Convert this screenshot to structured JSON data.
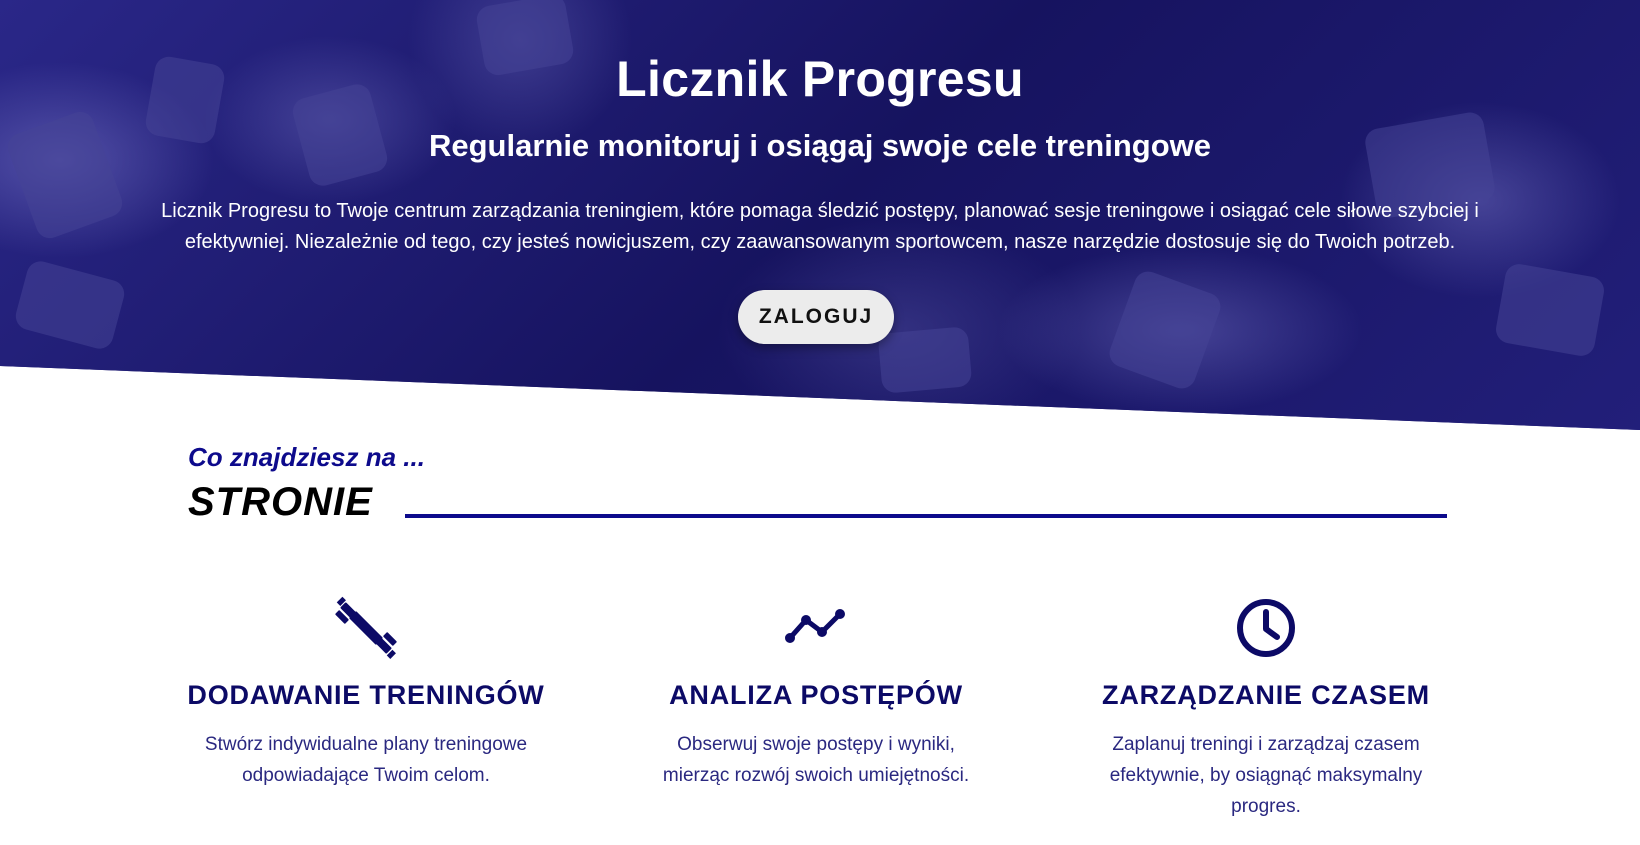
{
  "hero": {
    "title": "Licznik Progresu",
    "subtitle": "Regularnie monitoruj i osiągaj swoje cele treningowe",
    "description": "Licznik Progresu to Twoje centrum zarządzania treningiem, które pomaga śledzić postępy, planować sesje treningowe i osiągać cele siłowe szybciej i efektywniej. Niezależnie od tego, czy jesteś nowicjuszem, czy zaawansowanym sportowcem, nasze narzędzie dostosuje się do Twoich potrzeb.",
    "login_label": "ZALOGUJ"
  },
  "section": {
    "kicker": "Co znajdziesz na ...",
    "title": "STRONIE"
  },
  "features": [
    {
      "icon": "dumbbell-icon",
      "title": "DODAWANIE TRENINGÓW",
      "text": "Stwórz indywidualne plany treningowe odpowiadające Twoim celom."
    },
    {
      "icon": "chart-line-icon",
      "title": "ANALIZA POSTĘPÓW",
      "text": "Obserwuj swoje postępy i wyniki, mierząc rozwój swoich umiejętności."
    },
    {
      "icon": "clock-icon",
      "title": "ZARZĄDZANIE CZASEM",
      "text": "Zaplanuj treningi i zarządzaj czasem efektywnie, by osiągnąć maksymalny progres."
    }
  ],
  "colors": {
    "hero_background": "#1b1872",
    "accent": "#0d0a8c",
    "feature_title": "#0c0a66",
    "button_background": "#ececec"
  }
}
